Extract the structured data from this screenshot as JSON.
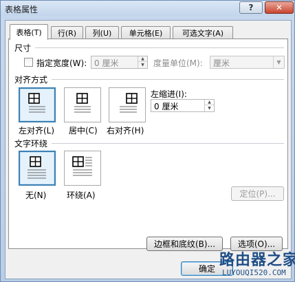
{
  "window": {
    "title": "表格属性",
    "help": "?",
    "close": "✕"
  },
  "tabs": [
    "表格(T)",
    "行(R)",
    "列(U)",
    "单元格(E)",
    "可选文字(A)"
  ],
  "size": {
    "section_label": "尺寸",
    "preferred_width_label": "指定宽度(W):",
    "preferred_width_value": "0 厘米",
    "measure_in_label": "度量单位(M):",
    "measure_in_value": "厘米"
  },
  "alignment": {
    "section_label": "对齐方式",
    "options": [
      "左对齐(L)",
      "居中(C)",
      "右对齐(H)"
    ],
    "selected": "左对齐(L)",
    "indent_label": "左缩进(I):",
    "indent_value": "0 厘米"
  },
  "wrapping": {
    "section_label": "文字环绕",
    "options": [
      "无(N)",
      "环绕(A)"
    ],
    "selected": "无(N)",
    "positioning_button": "定位(P)..."
  },
  "buttons": {
    "borders": "边框和底纹(B)...",
    "options": "选项(O)...",
    "ok": "确定"
  },
  "watermark": {
    "main": "路由器之家",
    "sub": "LUYOUQI520.COM"
  }
}
